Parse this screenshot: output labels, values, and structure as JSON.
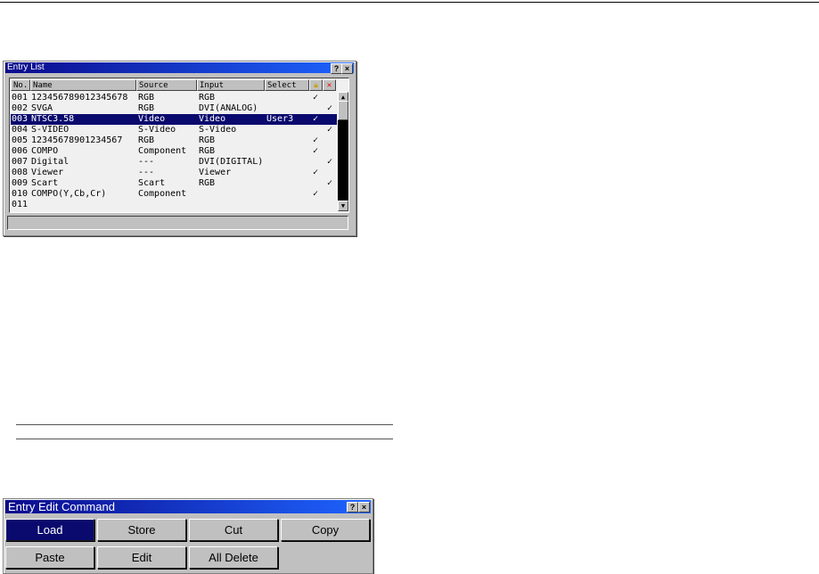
{
  "entry_list": {
    "title": "Entry List",
    "headers": {
      "no": "No.",
      "name": "Name",
      "source": "Source",
      "input": "Input",
      "select": "Select"
    },
    "rows": [
      {
        "no": "001",
        "name": "123456789012345678",
        "source": "RGB",
        "input": "RGB",
        "select": "",
        "lock": "✓",
        "del": ""
      },
      {
        "no": "002",
        "name": "SVGA",
        "source": "RGB",
        "input": "DVI(ANALOG)",
        "select": "",
        "lock": "",
        "del": "✓"
      },
      {
        "no": "003",
        "name": "NTSC3.58",
        "source": "Video",
        "input": "Video",
        "select": "User3",
        "lock": "✓",
        "del": ""
      },
      {
        "no": "004",
        "name": "S-VIDEO",
        "source": "S-Video",
        "input": "S-Video",
        "select": "",
        "lock": "",
        "del": "✓"
      },
      {
        "no": "005",
        "name": "12345678901234567",
        "source": "RGB",
        "input": "RGB",
        "select": "",
        "lock": "✓",
        "del": ""
      },
      {
        "no": "006",
        "name": "COMPO",
        "source": "Component",
        "input": "RGB",
        "select": "",
        "lock": "✓",
        "del": ""
      },
      {
        "no": "007",
        "name": "Digital",
        "source": "---",
        "input": "DVI(DIGITAL)",
        "select": "",
        "lock": "",
        "del": "✓"
      },
      {
        "no": "008",
        "name": "Viewer",
        "source": "---",
        "input": "Viewer",
        "select": "",
        "lock": "✓",
        "del": ""
      },
      {
        "no": "009",
        "name": "Scart",
        "source": "Scart",
        "input": "RGB",
        "select": "",
        "lock": "",
        "del": "✓"
      },
      {
        "no": "010",
        "name": "COMPO(Y,Cb,Cr)",
        "source": "Component",
        "input": "",
        "select": "",
        "lock": "✓",
        "del": ""
      },
      {
        "no": "011",
        "name": "",
        "source": "",
        "input": "",
        "select": "",
        "lock": "",
        "del": ""
      }
    ],
    "selected_index": 2
  },
  "entry_edit_command": {
    "title": "Entry Edit Command",
    "buttons": [
      "Load",
      "Store",
      "Cut",
      "Copy",
      "Paste",
      "Edit",
      "All Delete"
    ]
  },
  "title_buttons": {
    "help": "?",
    "close": "×"
  }
}
